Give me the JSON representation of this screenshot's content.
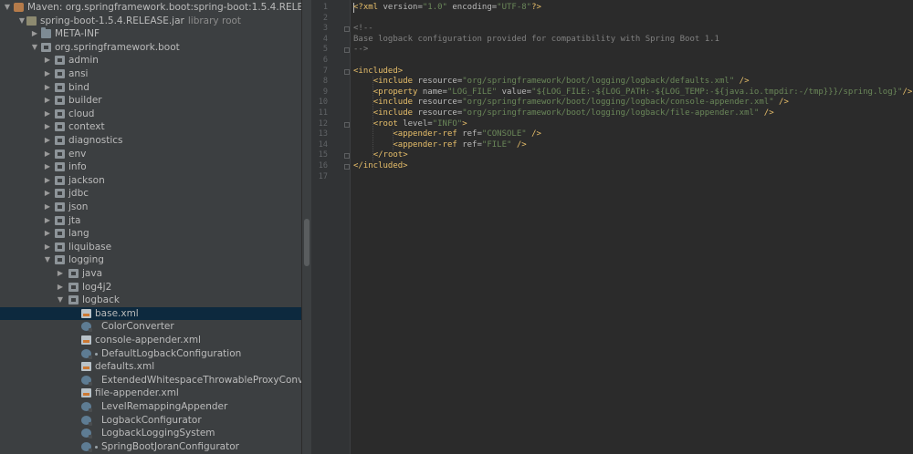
{
  "tree": {
    "items": [
      {
        "label": "Maven: org.springframework.boot:spring-boot:1.5.4.RELEASE",
        "icon": "maven-library-icon",
        "indent": 0,
        "arrow": "down",
        "kind": "maven"
      },
      {
        "label": "spring-boot-1.5.4.RELEASE.jar",
        "extra": "library root",
        "icon": "jar-icon",
        "indent": 1,
        "arrow": "down",
        "kind": "jar"
      },
      {
        "label": "META-INF",
        "icon": "folder-icon",
        "indent": 2,
        "arrow": "right",
        "kind": "folder"
      },
      {
        "label": "org.springframework.boot",
        "icon": "package-icon",
        "indent": 2,
        "arrow": "down",
        "kind": "pkg"
      },
      {
        "label": "admin",
        "icon": "package-icon",
        "indent": 3,
        "arrow": "right",
        "kind": "pkg"
      },
      {
        "label": "ansi",
        "icon": "package-icon",
        "indent": 3,
        "arrow": "right",
        "kind": "pkg"
      },
      {
        "label": "bind",
        "icon": "package-icon",
        "indent": 3,
        "arrow": "right",
        "kind": "pkg"
      },
      {
        "label": "builder",
        "icon": "package-icon",
        "indent": 3,
        "arrow": "right",
        "kind": "pkg"
      },
      {
        "label": "cloud",
        "icon": "package-icon",
        "indent": 3,
        "arrow": "right",
        "kind": "pkg"
      },
      {
        "label": "context",
        "icon": "package-icon",
        "indent": 3,
        "arrow": "right",
        "kind": "pkg"
      },
      {
        "label": "diagnostics",
        "icon": "package-icon",
        "indent": 3,
        "arrow": "right",
        "kind": "pkg"
      },
      {
        "label": "env",
        "icon": "package-icon",
        "indent": 3,
        "arrow": "right",
        "kind": "pkg"
      },
      {
        "label": "info",
        "icon": "package-icon",
        "indent": 3,
        "arrow": "right",
        "kind": "pkg"
      },
      {
        "label": "jackson",
        "icon": "package-icon",
        "indent": 3,
        "arrow": "right",
        "kind": "pkg"
      },
      {
        "label": "jdbc",
        "icon": "package-icon",
        "indent": 3,
        "arrow": "right",
        "kind": "pkg"
      },
      {
        "label": "json",
        "icon": "package-icon",
        "indent": 3,
        "arrow": "right",
        "kind": "pkg"
      },
      {
        "label": "jta",
        "icon": "package-icon",
        "indent": 3,
        "arrow": "right",
        "kind": "pkg"
      },
      {
        "label": "lang",
        "icon": "package-icon",
        "indent": 3,
        "arrow": "right",
        "kind": "pkg"
      },
      {
        "label": "liquibase",
        "icon": "package-icon",
        "indent": 3,
        "arrow": "right",
        "kind": "pkg"
      },
      {
        "label": "logging",
        "icon": "package-icon",
        "indent": 3,
        "arrow": "down",
        "kind": "pkg"
      },
      {
        "label": "java",
        "icon": "package-icon",
        "indent": 4,
        "arrow": "right",
        "kind": "pkg"
      },
      {
        "label": "log4j2",
        "icon": "package-icon",
        "indent": 4,
        "arrow": "right",
        "kind": "pkg"
      },
      {
        "label": "logback",
        "icon": "package-icon",
        "indent": 4,
        "arrow": "down",
        "kind": "pkg"
      },
      {
        "label": "base.xml",
        "icon": "xml-file-icon",
        "indent": 5,
        "arrow": "",
        "kind": "xml",
        "selected": true
      },
      {
        "label": "ColorConverter",
        "icon": "class-icon",
        "indent": 5,
        "arrow": "",
        "kind": "class",
        "dot": false
      },
      {
        "label": "console-appender.xml",
        "icon": "xml-file-icon",
        "indent": 5,
        "arrow": "",
        "kind": "xml"
      },
      {
        "label": "DefaultLogbackConfiguration",
        "icon": "class-icon",
        "indent": 5,
        "arrow": "",
        "kind": "class",
        "dot": true
      },
      {
        "label": "defaults.xml",
        "icon": "xml-file-icon",
        "indent": 5,
        "arrow": "",
        "kind": "xml"
      },
      {
        "label": "ExtendedWhitespaceThrowableProxyConv",
        "icon": "class-icon",
        "indent": 5,
        "arrow": "",
        "kind": "class",
        "dot": false
      },
      {
        "label": "file-appender.xml",
        "icon": "xml-file-icon",
        "indent": 5,
        "arrow": "",
        "kind": "xml"
      },
      {
        "label": "LevelRemappingAppender",
        "icon": "class-icon",
        "indent": 5,
        "arrow": "",
        "kind": "class",
        "dot": false
      },
      {
        "label": "LogbackConfigurator",
        "icon": "class-icon",
        "indent": 5,
        "arrow": "",
        "kind": "class",
        "dot": false
      },
      {
        "label": "LogbackLoggingSystem",
        "icon": "class-icon",
        "indent": 5,
        "arrow": "",
        "kind": "class",
        "dot": false
      },
      {
        "label": "SpringBootJoranConfigurator",
        "icon": "class-icon",
        "indent": 5,
        "arrow": "",
        "kind": "class",
        "dot": true
      }
    ]
  },
  "editor": {
    "line_numbers": [
      "1",
      "2",
      "3",
      "4",
      "5",
      "6",
      "7",
      "8",
      "9",
      "10",
      "11",
      "12",
      "13",
      "14",
      "15",
      "16",
      "17"
    ],
    "lines": [
      [
        {
          "t": "tag",
          "s": "<?xml "
        },
        {
          "t": "attr",
          "s": "version="
        },
        {
          "t": "val",
          "s": "\"1.0\" "
        },
        {
          "t": "attr",
          "s": "encoding="
        },
        {
          "t": "val",
          "s": "\"UTF-8\""
        },
        {
          "t": "tag",
          "s": "?>"
        }
      ],
      [],
      [
        {
          "t": "cmt",
          "s": "<!--"
        }
      ],
      [
        {
          "t": "cmt",
          "s": "Base logback configuration provided for compatibility with Spring Boot 1.1"
        }
      ],
      [
        {
          "t": "cmt",
          "s": "-->"
        }
      ],
      [],
      [
        {
          "t": "tag",
          "s": "<included>"
        }
      ],
      [
        {
          "t": "txt",
          "s": "    "
        },
        {
          "t": "tag",
          "s": "<include "
        },
        {
          "t": "attr",
          "s": "resource="
        },
        {
          "t": "val",
          "s": "\"org/springframework/boot/logging/logback/defaults.xml\""
        },
        {
          "t": "tag",
          "s": " />"
        }
      ],
      [
        {
          "t": "txt",
          "s": "    "
        },
        {
          "t": "tag",
          "s": "<property "
        },
        {
          "t": "attr",
          "s": "name="
        },
        {
          "t": "val",
          "s": "\"LOG_FILE\" "
        },
        {
          "t": "attr",
          "s": "value="
        },
        {
          "t": "val",
          "s": "\"${LOG_FILE:-${LOG_PATH:-${LOG_TEMP:-${java.io.tmpdir:-/tmp}}}/spring.log}\""
        },
        {
          "t": "tag",
          "s": "/>"
        }
      ],
      [
        {
          "t": "txt",
          "s": "    "
        },
        {
          "t": "tag",
          "s": "<include "
        },
        {
          "t": "attr",
          "s": "resource="
        },
        {
          "t": "val",
          "s": "\"org/springframework/boot/logging/logback/console-appender.xml\""
        },
        {
          "t": "tag",
          "s": " />"
        }
      ],
      [
        {
          "t": "txt",
          "s": "    "
        },
        {
          "t": "tag",
          "s": "<include "
        },
        {
          "t": "attr",
          "s": "resource="
        },
        {
          "t": "val",
          "s": "\"org/springframework/boot/logging/logback/file-appender.xml\""
        },
        {
          "t": "tag",
          "s": " />"
        }
      ],
      [
        {
          "t": "txt",
          "s": "    "
        },
        {
          "t": "tag",
          "s": "<root "
        },
        {
          "t": "attr",
          "s": "level="
        },
        {
          "t": "val",
          "s": "\"INFO\""
        },
        {
          "t": "tag",
          "s": ">"
        }
      ],
      [
        {
          "t": "txt",
          "s": "        "
        },
        {
          "t": "tag",
          "s": "<appender-ref "
        },
        {
          "t": "attr",
          "s": "ref="
        },
        {
          "t": "val",
          "s": "\"CONSOLE\""
        },
        {
          "t": "tag",
          "s": " />"
        }
      ],
      [
        {
          "t": "txt",
          "s": "        "
        },
        {
          "t": "tag",
          "s": "<appender-ref "
        },
        {
          "t": "attr",
          "s": "ref="
        },
        {
          "t": "val",
          "s": "\"FILE\""
        },
        {
          "t": "tag",
          "s": " />"
        }
      ],
      [
        {
          "t": "txt",
          "s": "    "
        },
        {
          "t": "tag",
          "s": "</root>"
        }
      ],
      [
        {
          "t": "tag",
          "s": "</included>"
        }
      ],
      []
    ]
  },
  "colors": {
    "tree_bg": "#3c3f41",
    "editor_bg": "#2b2b2b",
    "selection": "#0d293e",
    "tag": "#e8bf6a",
    "value": "#6a8759",
    "comment": "#808080"
  }
}
